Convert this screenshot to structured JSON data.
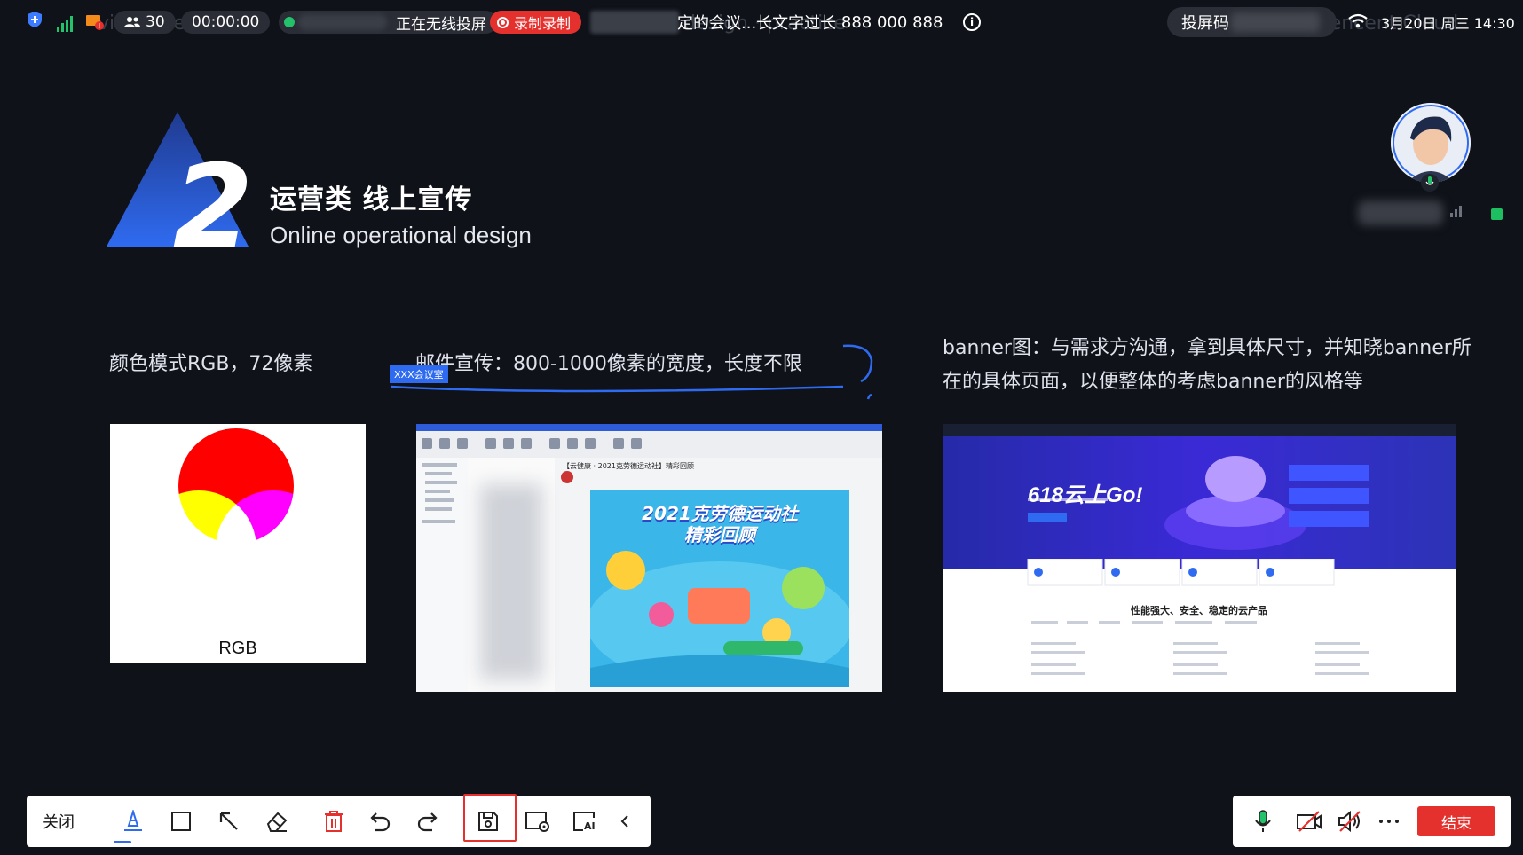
{
  "status_bar": {
    "participant_count": "30",
    "timer": "00:00:00",
    "cast_status": "正在无线投屏",
    "record_label": "录制录制",
    "meeting_name": "定的会议...长文字过长",
    "meeting_id": "888 000 888",
    "cast_code_label": "投屏码",
    "datetime": "3月20日 周三 14:30",
    "watermarks": [
      "visual design",
      "design · practice",
      "Tencent Cloud"
    ]
  },
  "slide": {
    "number": "2",
    "title_cn": "运营类 线上宣传",
    "title_en": "Online operational design",
    "caption_rgb": "颜色模式RGB，72像素",
    "caption_email": "邮件宣传：800-1000像素的宽度，长度不限",
    "caption_banner": "banner图：与需求方沟通，拿到具体尺寸，并知晓banner所在的具体页面，以便整体的考虑banner的风格等",
    "annotation_tag": "XXX会议室",
    "rgb_label": "RGB",
    "email_subject": "【云健康 · 2021克劳德运动社】精彩回顾",
    "poster_title_1": "2021克劳德运动社",
    "poster_title_2": "精彩回顾",
    "banner_headline": "618云上Go!",
    "banner_tagline": "性能强大、安全、稳定的云产品"
  },
  "toolbar": {
    "close_label": "关闭",
    "tools": [
      "pen-icon",
      "rectangle-icon",
      "pointer-icon",
      "eraser-icon",
      "delete-icon",
      "undo-icon",
      "redo-icon",
      "save-icon",
      "screenshot-settings-icon",
      "ai-icon",
      "collapse-icon"
    ]
  },
  "meeting_controls": {
    "end_label": "结束"
  },
  "colors": {
    "accent_blue": "#2f6bf0",
    "record_red": "#e5312d",
    "signal_green": "#23c26b",
    "background": "#0f1219"
  }
}
